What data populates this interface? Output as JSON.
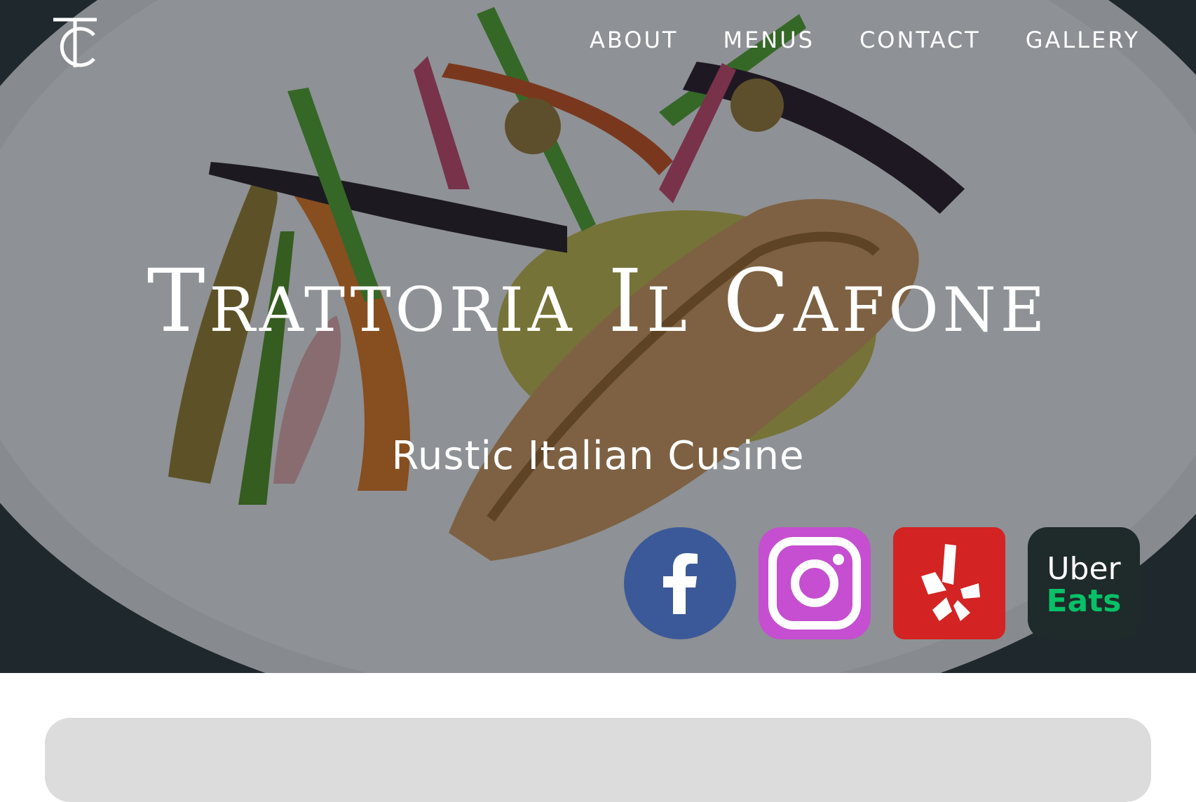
{
  "site": {
    "nav": [
      "ABOUT",
      "MENUS",
      "CONTACT",
      "GALLERY"
    ],
    "title": "Trattoria Il Cafone",
    "subtitle": "Rustic Italian Cusine"
  },
  "social": [
    {
      "name": "facebook",
      "icon": "facebook-icon",
      "color": "#3b5998"
    },
    {
      "name": "instagram",
      "icon": "instagram-icon",
      "color": "#c54fd0"
    },
    {
      "name": "yelp",
      "icon": "yelp-icon",
      "color": "#d32323"
    },
    {
      "name": "uber-eats",
      "icon": "uber-eats-icon",
      "color": "#1f2a2a",
      "label_top": "Uber",
      "label_bottom": "Eats"
    }
  ],
  "colors": {
    "nav_text": "#ffffff",
    "hero_text": "#ffffff",
    "panel": "#dcdcdc"
  }
}
